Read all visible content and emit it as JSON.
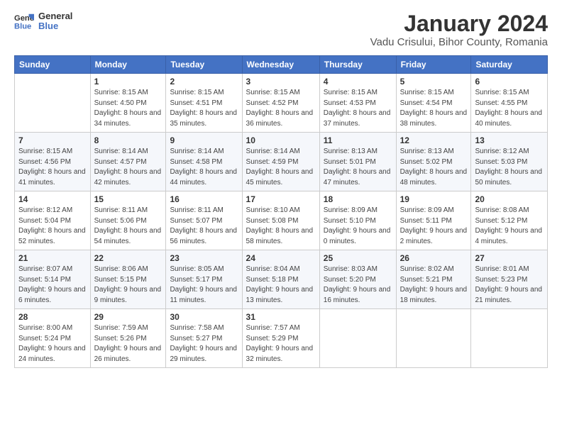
{
  "header": {
    "logo_general": "General",
    "logo_blue": "Blue",
    "month_title": "January 2024",
    "location": "Vadu Crisului, Bihor County, Romania"
  },
  "days_of_week": [
    "Sunday",
    "Monday",
    "Tuesday",
    "Wednesday",
    "Thursday",
    "Friday",
    "Saturday"
  ],
  "weeks": [
    [
      {
        "day": "",
        "sunrise": "",
        "sunset": "",
        "daylight": ""
      },
      {
        "day": "1",
        "sunrise": "Sunrise: 8:15 AM",
        "sunset": "Sunset: 4:50 PM",
        "daylight": "Daylight: 8 hours and 34 minutes."
      },
      {
        "day": "2",
        "sunrise": "Sunrise: 8:15 AM",
        "sunset": "Sunset: 4:51 PM",
        "daylight": "Daylight: 8 hours and 35 minutes."
      },
      {
        "day": "3",
        "sunrise": "Sunrise: 8:15 AM",
        "sunset": "Sunset: 4:52 PM",
        "daylight": "Daylight: 8 hours and 36 minutes."
      },
      {
        "day": "4",
        "sunrise": "Sunrise: 8:15 AM",
        "sunset": "Sunset: 4:53 PM",
        "daylight": "Daylight: 8 hours and 37 minutes."
      },
      {
        "day": "5",
        "sunrise": "Sunrise: 8:15 AM",
        "sunset": "Sunset: 4:54 PM",
        "daylight": "Daylight: 8 hours and 38 minutes."
      },
      {
        "day": "6",
        "sunrise": "Sunrise: 8:15 AM",
        "sunset": "Sunset: 4:55 PM",
        "daylight": "Daylight: 8 hours and 40 minutes."
      }
    ],
    [
      {
        "day": "7",
        "sunrise": "Sunrise: 8:15 AM",
        "sunset": "Sunset: 4:56 PM",
        "daylight": "Daylight: 8 hours and 41 minutes."
      },
      {
        "day": "8",
        "sunrise": "Sunrise: 8:14 AM",
        "sunset": "Sunset: 4:57 PM",
        "daylight": "Daylight: 8 hours and 42 minutes."
      },
      {
        "day": "9",
        "sunrise": "Sunrise: 8:14 AM",
        "sunset": "Sunset: 4:58 PM",
        "daylight": "Daylight: 8 hours and 44 minutes."
      },
      {
        "day": "10",
        "sunrise": "Sunrise: 8:14 AM",
        "sunset": "Sunset: 4:59 PM",
        "daylight": "Daylight: 8 hours and 45 minutes."
      },
      {
        "day": "11",
        "sunrise": "Sunrise: 8:13 AM",
        "sunset": "Sunset: 5:01 PM",
        "daylight": "Daylight: 8 hours and 47 minutes."
      },
      {
        "day": "12",
        "sunrise": "Sunrise: 8:13 AM",
        "sunset": "Sunset: 5:02 PM",
        "daylight": "Daylight: 8 hours and 48 minutes."
      },
      {
        "day": "13",
        "sunrise": "Sunrise: 8:12 AM",
        "sunset": "Sunset: 5:03 PM",
        "daylight": "Daylight: 8 hours and 50 minutes."
      }
    ],
    [
      {
        "day": "14",
        "sunrise": "Sunrise: 8:12 AM",
        "sunset": "Sunset: 5:04 PM",
        "daylight": "Daylight: 8 hours and 52 minutes."
      },
      {
        "day": "15",
        "sunrise": "Sunrise: 8:11 AM",
        "sunset": "Sunset: 5:06 PM",
        "daylight": "Daylight: 8 hours and 54 minutes."
      },
      {
        "day": "16",
        "sunrise": "Sunrise: 8:11 AM",
        "sunset": "Sunset: 5:07 PM",
        "daylight": "Daylight: 8 hours and 56 minutes."
      },
      {
        "day": "17",
        "sunrise": "Sunrise: 8:10 AM",
        "sunset": "Sunset: 5:08 PM",
        "daylight": "Daylight: 8 hours and 58 minutes."
      },
      {
        "day": "18",
        "sunrise": "Sunrise: 8:09 AM",
        "sunset": "Sunset: 5:10 PM",
        "daylight": "Daylight: 9 hours and 0 minutes."
      },
      {
        "day": "19",
        "sunrise": "Sunrise: 8:09 AM",
        "sunset": "Sunset: 5:11 PM",
        "daylight": "Daylight: 9 hours and 2 minutes."
      },
      {
        "day": "20",
        "sunrise": "Sunrise: 8:08 AM",
        "sunset": "Sunset: 5:12 PM",
        "daylight": "Daylight: 9 hours and 4 minutes."
      }
    ],
    [
      {
        "day": "21",
        "sunrise": "Sunrise: 8:07 AM",
        "sunset": "Sunset: 5:14 PM",
        "daylight": "Daylight: 9 hours and 6 minutes."
      },
      {
        "day": "22",
        "sunrise": "Sunrise: 8:06 AM",
        "sunset": "Sunset: 5:15 PM",
        "daylight": "Daylight: 9 hours and 9 minutes."
      },
      {
        "day": "23",
        "sunrise": "Sunrise: 8:05 AM",
        "sunset": "Sunset: 5:17 PM",
        "daylight": "Daylight: 9 hours and 11 minutes."
      },
      {
        "day": "24",
        "sunrise": "Sunrise: 8:04 AM",
        "sunset": "Sunset: 5:18 PM",
        "daylight": "Daylight: 9 hours and 13 minutes."
      },
      {
        "day": "25",
        "sunrise": "Sunrise: 8:03 AM",
        "sunset": "Sunset: 5:20 PM",
        "daylight": "Daylight: 9 hours and 16 minutes."
      },
      {
        "day": "26",
        "sunrise": "Sunrise: 8:02 AM",
        "sunset": "Sunset: 5:21 PM",
        "daylight": "Daylight: 9 hours and 18 minutes."
      },
      {
        "day": "27",
        "sunrise": "Sunrise: 8:01 AM",
        "sunset": "Sunset: 5:23 PM",
        "daylight": "Daylight: 9 hours and 21 minutes."
      }
    ],
    [
      {
        "day": "28",
        "sunrise": "Sunrise: 8:00 AM",
        "sunset": "Sunset: 5:24 PM",
        "daylight": "Daylight: 9 hours and 24 minutes."
      },
      {
        "day": "29",
        "sunrise": "Sunrise: 7:59 AM",
        "sunset": "Sunset: 5:26 PM",
        "daylight": "Daylight: 9 hours and 26 minutes."
      },
      {
        "day": "30",
        "sunrise": "Sunrise: 7:58 AM",
        "sunset": "Sunset: 5:27 PM",
        "daylight": "Daylight: 9 hours and 29 minutes."
      },
      {
        "day": "31",
        "sunrise": "Sunrise: 7:57 AM",
        "sunset": "Sunset: 5:29 PM",
        "daylight": "Daylight: 9 hours and 32 minutes."
      },
      {
        "day": "",
        "sunrise": "",
        "sunset": "",
        "daylight": ""
      },
      {
        "day": "",
        "sunrise": "",
        "sunset": "",
        "daylight": ""
      },
      {
        "day": "",
        "sunrise": "",
        "sunset": "",
        "daylight": ""
      }
    ]
  ]
}
